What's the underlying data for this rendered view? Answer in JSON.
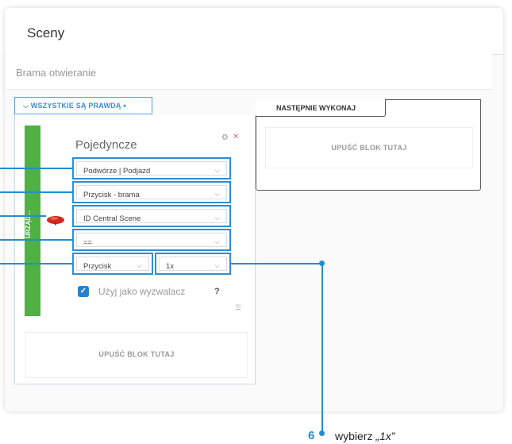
{
  "header": {
    "title": "Sceny"
  },
  "scene": {
    "name": "Brama otwieranie"
  },
  "if_block": {
    "label": "WSZYSTKIE SĄ PRAWDĄ",
    "chevron": "▾",
    "side_label": "URZĄD...",
    "card": {
      "title": "Pojedyncze",
      "settings_icon": "⚙",
      "close_icon": "×",
      "selects": {
        "room": "Podwórze | Podjazd",
        "device": "Przycisk - brama",
        "property": "ID Central Scene",
        "operator": "==",
        "event_type": "Przycisk",
        "value": "1x"
      },
      "trigger_checkbox_label": "Użyj jako wyzwalacz",
      "trigger_checked": true,
      "help": "?"
    },
    "drop_label": "UPUŚĆ BLOK TUTAJ"
  },
  "then_block": {
    "label": "NASTĘPNIE WYKONAJ",
    "drop_label": "UPUŚĆ BLOK TUTAJ"
  },
  "callout": {
    "number": "6",
    "text_prefix": "wybierz ",
    "text_value": "„1x”",
    "color": "#1f8fd3"
  },
  "colors": {
    "accent": "#2b8fd6",
    "green": "#4fb044",
    "close": "#e04848"
  }
}
